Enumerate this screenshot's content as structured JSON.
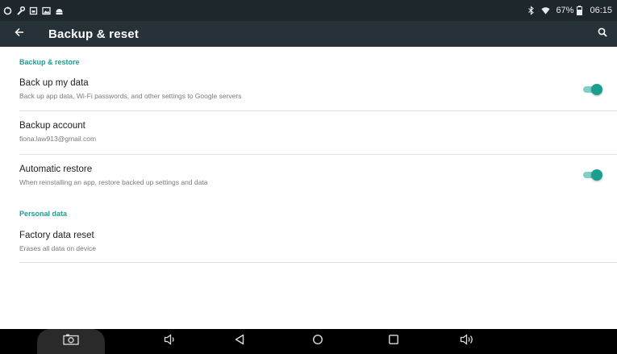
{
  "status_bar": {
    "battery": "67%",
    "time": "06:15",
    "left_icons": [
      "sync-icon",
      "wrench-icon",
      "sim-icon",
      "image-icon",
      "android-icon"
    ],
    "right_icons": [
      "bluetooth-icon",
      "wifi-icon",
      "battery-icon"
    ]
  },
  "app_bar": {
    "title": "Backup & reset",
    "back_icon": "arrow-back-icon",
    "search_icon": "search-icon"
  },
  "sections": {
    "backup_restore": {
      "header": "Backup & restore",
      "back_up_my_data": {
        "title": "Back up my data",
        "subtitle": "Back up app data, Wi-Fi passwords, and other settings to Google servers",
        "enabled": true
      },
      "backup_account": {
        "title": "Backup account",
        "subtitle": "fiona.law913@gmail.com"
      },
      "automatic_restore": {
        "title": "Automatic restore",
        "subtitle": "When reinstalling an app, restore backed up settings and data",
        "enabled": true
      }
    },
    "personal_data": {
      "header": "Personal data",
      "factory_reset": {
        "title": "Factory data reset",
        "subtitle": "Erases all data on device"
      }
    }
  },
  "nav_bar": {
    "buttons": [
      "screenshot-icon",
      "volume-down-icon",
      "back-icon",
      "home-icon",
      "recents-icon",
      "volume-up-icon"
    ]
  },
  "colors": {
    "status_bar_bg": "#1e272c",
    "app_bar_bg": "#263238",
    "accent": "#1b9e8e",
    "nav_bar_bg": "#000000"
  }
}
